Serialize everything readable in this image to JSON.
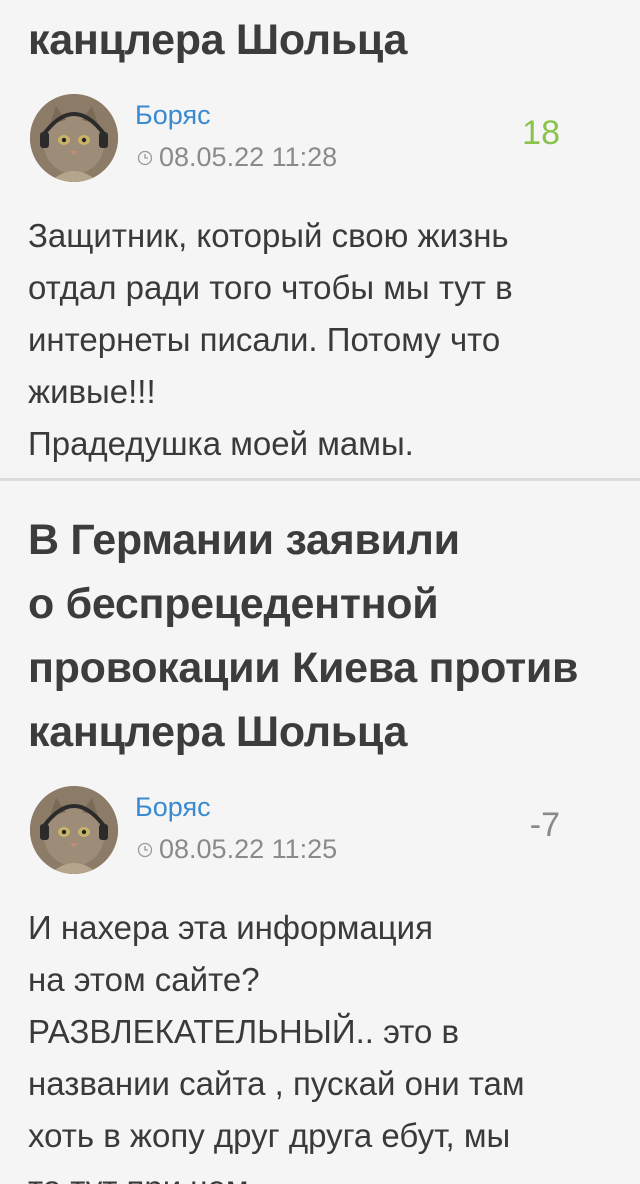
{
  "posts": [
    {
      "article_title": "провокации Киева против\nканцлера Шольца",
      "comment": {
        "author": "Боряс",
        "date": "08.05.22 11:28",
        "rating": "18",
        "text": "Защитник, который свою жизнь\nотдал ради того чтобы мы тут в\nинтернеты писали. Потому что\nживые!!!\nПрадедушка моей мамы."
      }
    },
    {
      "article_title": "В Германии заявили\nо беспрецедентной\nпровокации Киева против\nканцлера Шольца",
      "comment": {
        "author": "Боряс",
        "date": "08.05.22 11:25",
        "rating": "-7",
        "text": "И нахера эта информация\nна этом сайте?\nРАЗВЛЕКАТЕЛЬНЫЙ.. это в\nназвании сайта , пускай они там\nхоть в жопу друг друга ебут, мы\nто тут при чем."
      }
    }
  ],
  "colors": {
    "author_link": "#3a8ad0",
    "rating_positive": "#8bc34a",
    "rating_negative": "#8a8a8a",
    "title_text": "#3c3c3c",
    "background": "#f5f5f5"
  },
  "icons": {
    "date": "clock-icon",
    "avatar": "cat-with-headphones-avatar"
  }
}
